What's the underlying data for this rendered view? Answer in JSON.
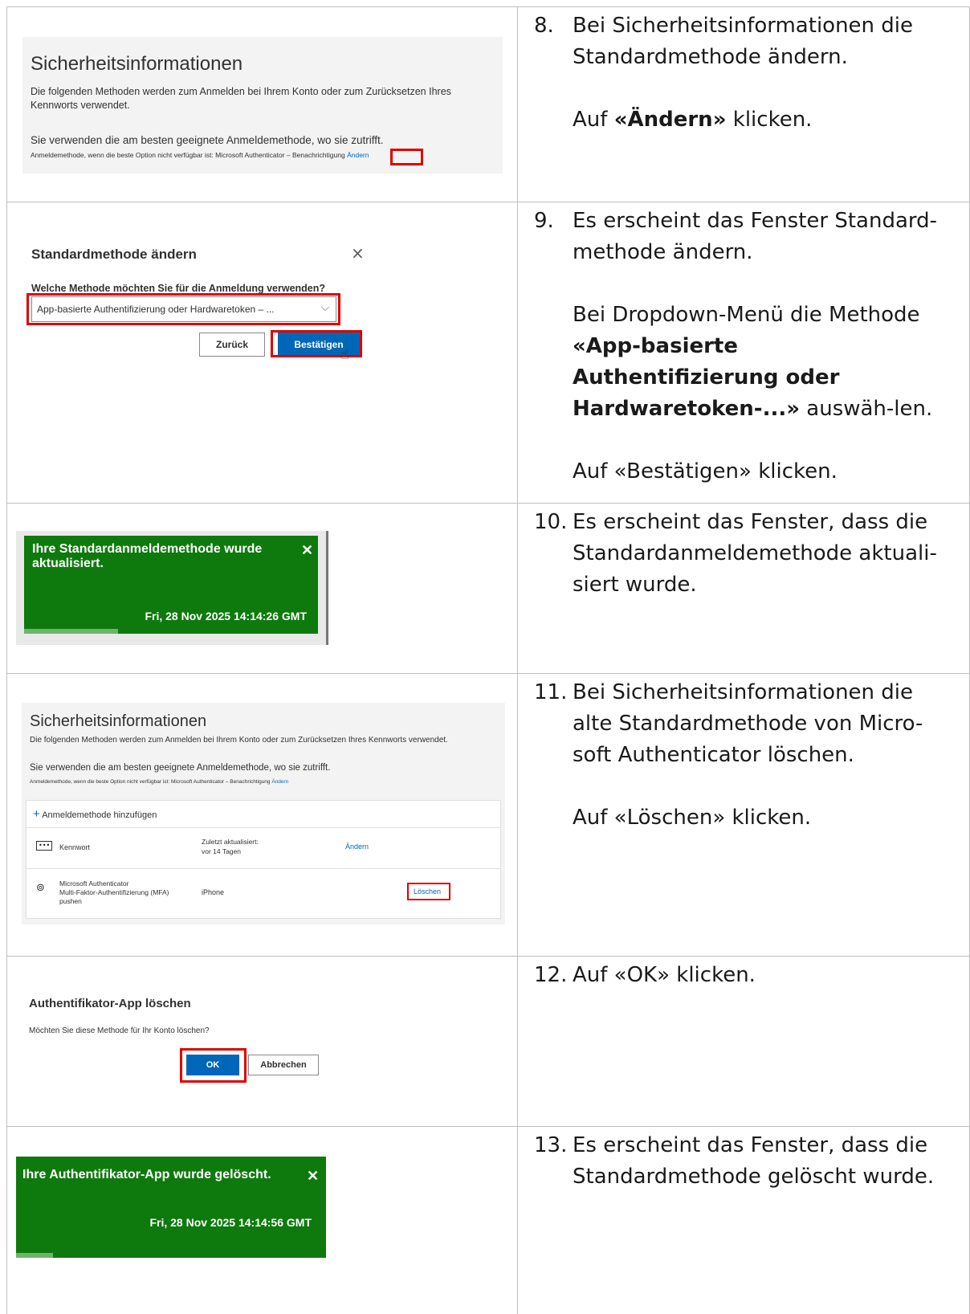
{
  "steps": [
    {
      "number": "8.",
      "lines": [
        "Bei Sicherheitsinformationen die Standardmethode ändern."
      ],
      "action_prefix": "Auf ",
      "action_bold": "«Ändern»",
      "action_suffix": " klicken."
    },
    {
      "number": "9.",
      "lines": [
        "Es erscheint das Fenster Standard-",
        "methode ändern."
      ],
      "para2_prefix": "Bei Dropdown-Menü die Methode ",
      "para2_bold": "«App-basierte Authentifizierung oder Hardwaretoken-...»",
      "para2_suffix": " auswäh-len.",
      "para3": "Auf «Bestätigen» klicken."
    },
    {
      "number": "10.",
      "lines": [
        "Es erscheint das Fenster, dass die Standardanmeldemethode aktuali-siert wurde."
      ]
    },
    {
      "number": "11.",
      "lines": [
        "Bei Sicherheitsinformationen die alte Standardmethode von Micro-soft Authenticator löschen."
      ],
      "para2": "Auf «Löschen» klicken."
    },
    {
      "number": "12.",
      "lines": [
        "Auf «OK» klicken."
      ]
    },
    {
      "number": "13.",
      "lines": [
        "Es erscheint das Fenster, dass die Standardmethode gelöscht wurde."
      ]
    }
  ],
  "panel1": {
    "title": "Sicherheitsinformationen",
    "description": "Die folgenden Methoden werden zum Anmelden bei Ihrem Konto oder zum Zurücksetzen Ihres Kennworts verwendet.",
    "best_method": "Sie verwenden die am besten geeignete Anmeldemethode, wo sie zutrifft.",
    "fallback": "Anmeldemethode, wenn die beste Option nicht verfügbar ist: Microsoft Authenticator – Benachrichtigung",
    "change_link": "Ändern"
  },
  "panel2": {
    "title": "Standardmethode ändern",
    "question": "Welche Methode möchten Sie für die Anmeldung verwenden?",
    "selected": "App-basierte Authentifizierung oder Hardwaretoken – ...",
    "back": "Zurück",
    "confirm": "Bestätigen"
  },
  "panel3": {
    "message": "Ihre Standardanmeldemethode wurde aktualisiert.",
    "timestamp": "Fri, 28 Nov 2025 14:14:26 GMT",
    "progress": 0.32
  },
  "panel4": {
    "title": "Sicherheitsinformationen",
    "description": "Die folgenden Methoden werden zum Anmelden bei Ihrem Konto oder zum Zurücksetzen Ihres Kennworts verwendet.",
    "best_method": "Sie verwenden die am besten geeignete Anmeldemethode, wo sie zutrifft.",
    "fallback": "Anmeldemethode, wenn die beste Option nicht verfügbar ist: Microsoft Authenticator – Benachrichtigung",
    "change_link": "Ändern",
    "add_method": "Anmeldemethode hinzufügen",
    "methods": [
      {
        "name": "Kennwort",
        "detail": "Zuletzt aktualisiert:",
        "detail2": "vor 14 Tagen",
        "action": "Ändern"
      },
      {
        "name": "Microsoft Authenticator",
        "sub1": "Multi-Faktor-Authentifizierung (MFA)",
        "sub2": "pushen",
        "detail": "iPhone",
        "action": "Löschen"
      }
    ]
  },
  "panel5": {
    "title": "Authentifikator-App löschen",
    "question": "Möchten Sie diese Methode für Ihr Konto löschen?",
    "ok": "OK",
    "cancel": "Abbrechen"
  },
  "panel6": {
    "message": "Ihre Authentifikator-App wurde gelöscht.",
    "timestamp": "Fri, 28 Nov 2025 14:14:56 GMT",
    "progress": 0.12
  },
  "colors": {
    "toast_green": "#0e7a0d",
    "highlight_red": "#e00000",
    "primary_blue": "#0067b8"
  }
}
